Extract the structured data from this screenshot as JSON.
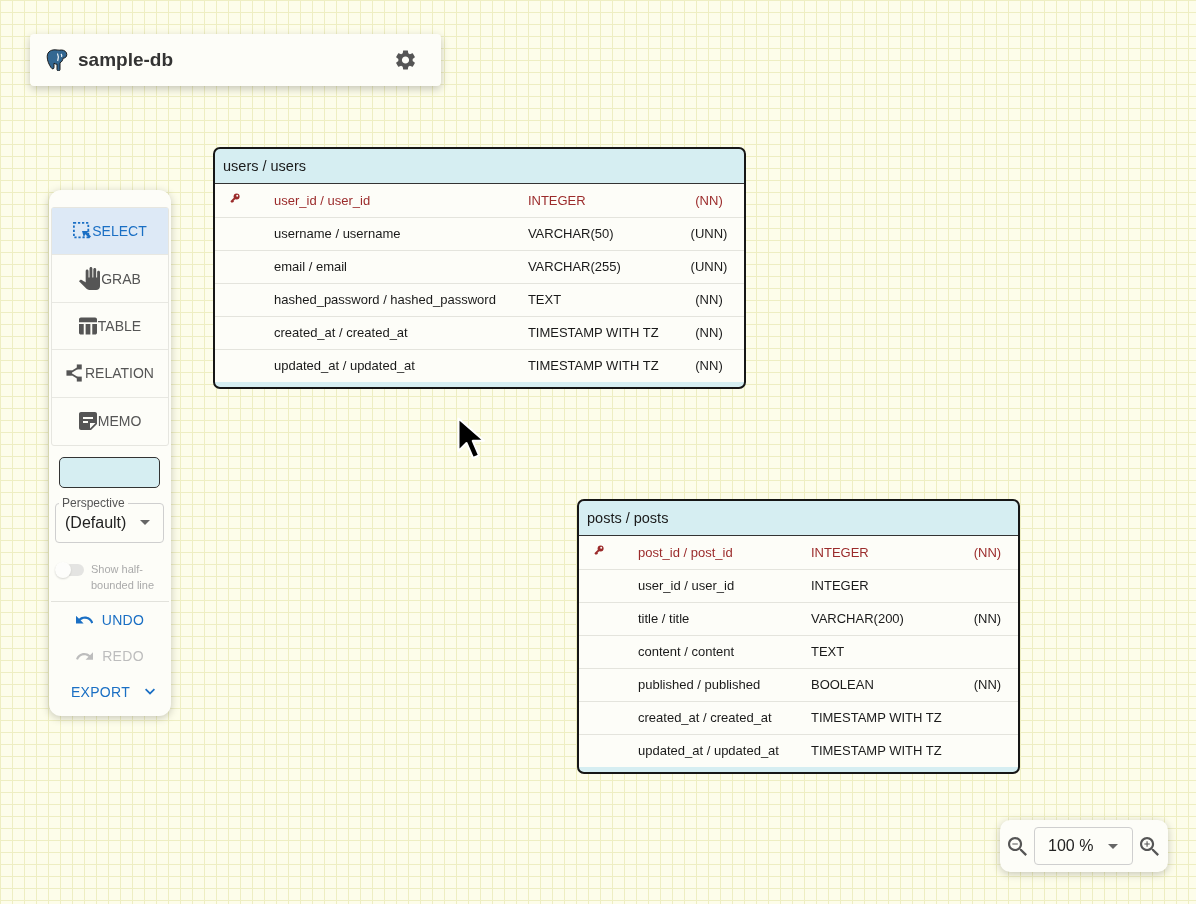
{
  "header": {
    "title": "sample-db"
  },
  "toolbar": {
    "tools": [
      {
        "kind": "select",
        "label": "SELECT",
        "selected": true
      },
      {
        "kind": "grab",
        "label": "GRAB",
        "selected": false
      },
      {
        "kind": "table",
        "label": "TABLE",
        "selected": false
      },
      {
        "kind": "relation",
        "label": "RELATION",
        "selected": false
      },
      {
        "kind": "memo",
        "label": "MEMO",
        "selected": false
      }
    ],
    "color_picker": {
      "color": "#d6eef2"
    },
    "perspective": {
      "label": "Perspective",
      "value": "(Default)"
    },
    "half_bounded_line": {
      "label": "Show half-bounded line",
      "on": false,
      "disabled": true
    },
    "actions": [
      {
        "kind": "undo",
        "label": "UNDO",
        "disabled": false
      },
      {
        "kind": "redo",
        "label": "REDO",
        "disabled": true
      },
      {
        "kind": "export",
        "label": "EXPORT",
        "disabled": false
      }
    ]
  },
  "tables": [
    {
      "title": "users / users",
      "columns": [
        {
          "name": "user_id / user_id",
          "type": "INTEGER",
          "constraint": "(NN)",
          "primary_key": true
        },
        {
          "name": "username / username",
          "type": "VARCHAR(50)",
          "constraint": "(UNN)",
          "primary_key": false
        },
        {
          "name": "email / email",
          "type": "VARCHAR(255)",
          "constraint": "(UNN)",
          "primary_key": false
        },
        {
          "name": "hashed_password / hashed_password",
          "type": "TEXT",
          "constraint": "(NN)",
          "primary_key": false
        },
        {
          "name": "created_at / created_at",
          "type": "TIMESTAMP WITH TZ",
          "constraint": "(NN)",
          "primary_key": false
        },
        {
          "name": "updated_at / updated_at",
          "type": "TIMESTAMP WITH TZ",
          "constraint": "(NN)",
          "primary_key": false
        }
      ]
    },
    {
      "title": "posts / posts",
      "columns": [
        {
          "name": "post_id / post_id",
          "type": "INTEGER",
          "constraint": "(NN)",
          "primary_key": true
        },
        {
          "name": "user_id / user_id",
          "type": "INTEGER",
          "primary_key": false
        },
        {
          "name": "title / title",
          "type": "VARCHAR(200)",
          "constraint": "(NN)",
          "primary_key": false
        },
        {
          "name": "content / content",
          "type": "TEXT",
          "primary_key": false
        },
        {
          "name": "published / published",
          "type": "BOOLEAN",
          "constraint": "(NN)",
          "primary_key": false
        },
        {
          "name": "created_at / created_at",
          "type": "TIMESTAMP WITH TZ",
          "primary_key": false
        },
        {
          "name": "updated_at / updated_at",
          "type": "TIMESTAMP WITH TZ",
          "primary_key": false
        }
      ]
    }
  ],
  "zoom": {
    "value": "100 %"
  }
}
